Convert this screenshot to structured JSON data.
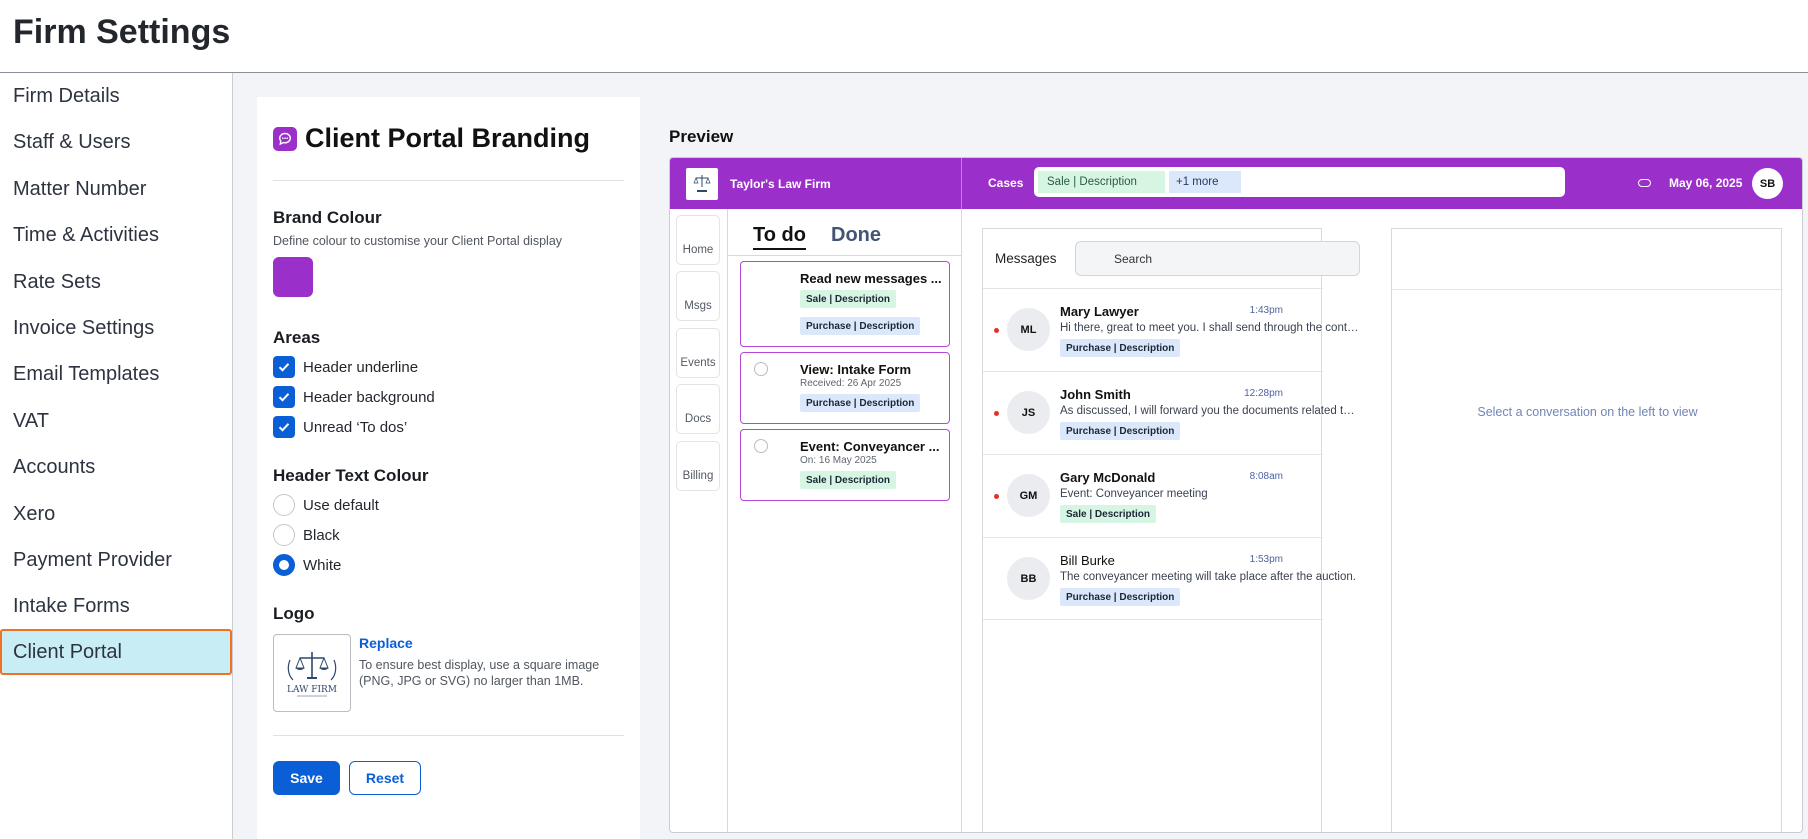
{
  "page": {
    "title": "Firm Settings"
  },
  "sidebar": {
    "items": [
      {
        "label": "Firm Details"
      },
      {
        "label": "Staff & Users"
      },
      {
        "label": "Matter Number"
      },
      {
        "label": "Time & Activities"
      },
      {
        "label": "Rate Sets"
      },
      {
        "label": "Invoice Settings"
      },
      {
        "label": "Email Templates"
      },
      {
        "label": "VAT"
      },
      {
        "label": "Accounts"
      },
      {
        "label": "Xero"
      },
      {
        "label": "Payment Provider"
      },
      {
        "label": "Intake Forms"
      },
      {
        "label": "Client Portal",
        "active": true
      }
    ]
  },
  "settings": {
    "title": "Client Portal Branding",
    "title_icon": "chat-bubble-icon",
    "brand_colour": {
      "label": "Brand Colour",
      "description": "Define colour to customise your Client Portal display",
      "value": "#9b2fc9"
    },
    "areas": {
      "label": "Areas",
      "options": [
        {
          "label": "Header underline",
          "checked": true
        },
        {
          "label": "Header background",
          "checked": true
        },
        {
          "label": "Unread ‘To dos’",
          "checked": true
        }
      ]
    },
    "header_text_colour": {
      "label": "Header Text Colour",
      "options": [
        {
          "label": "Use default",
          "selected": false
        },
        {
          "label": "Black",
          "selected": false
        },
        {
          "label": "White",
          "selected": true
        }
      ]
    },
    "logo": {
      "label": "Logo",
      "replace_label": "Replace",
      "hint": "To ensure best display, use a square image (PNG, JPG or SVG) no larger than 1MB.",
      "logo_text": "LAW FIRM"
    },
    "save_label": "Save",
    "reset_label": "Reset"
  },
  "preview": {
    "label": "Preview",
    "firm_name": "Taylor's Law Firm",
    "cases_label": "Cases",
    "case_chip": "Sale | Description",
    "more_chip": "+1 more",
    "date": "May 06, 2025",
    "avatar_initials": "SB",
    "nav": [
      "Home",
      "Msgs",
      "Events",
      "Docs",
      "Billing"
    ],
    "tabs": {
      "todo": "To do",
      "done": "Done"
    },
    "todos": [
      {
        "title": "Read new messages ...",
        "subtitle": "",
        "tags": [
          "Sale | Description",
          "Purchase | Description"
        ]
      },
      {
        "title": "View: Intake Form",
        "subtitle": "Received: 26 Apr 2025",
        "tags": [
          "Purchase | Description"
        ]
      },
      {
        "title": "Event: Conveyancer ...",
        "subtitle": "On: 16 May 2025",
        "tags": [
          "Sale | Description"
        ]
      }
    ],
    "messages": {
      "label": "Messages",
      "search_placeholder": "Search",
      "items": [
        {
          "initials": "ML",
          "name": "Mary Lawyer",
          "time": "1:43pm",
          "preview": "Hi there, great to meet you. I shall send through the contract shortly.",
          "tag": "Purchase | Description",
          "unread": true
        },
        {
          "initials": "JS",
          "name": "John Smith",
          "time": "12:28pm",
          "preview": "As discussed, I will forward you the documents related to the sale.",
          "tag": "Purchase | Description",
          "unread": true
        },
        {
          "initials": "GM",
          "name": "Gary McDonald",
          "time": "8:08am",
          "preview": "Event: Conveyancer meeting",
          "tag": "Sale | Description",
          "unread": true
        },
        {
          "initials": "BB",
          "name": "Bill Burke",
          "time": "1:53pm",
          "preview": "The conveyancer meeting will take place after the auction.",
          "tag": "Purchase | Description",
          "unread": false
        }
      ]
    },
    "conversation_empty": "Select a conversation on the left to view"
  },
  "colors": {
    "brand": "#9b2fc9",
    "primary": "#0b5fd6",
    "active_nav_bg": "#c9edf5",
    "active_nav_border": "#f07123",
    "sale_tag": "#d7f5e3",
    "purchase_tag": "#dbe8fb"
  }
}
